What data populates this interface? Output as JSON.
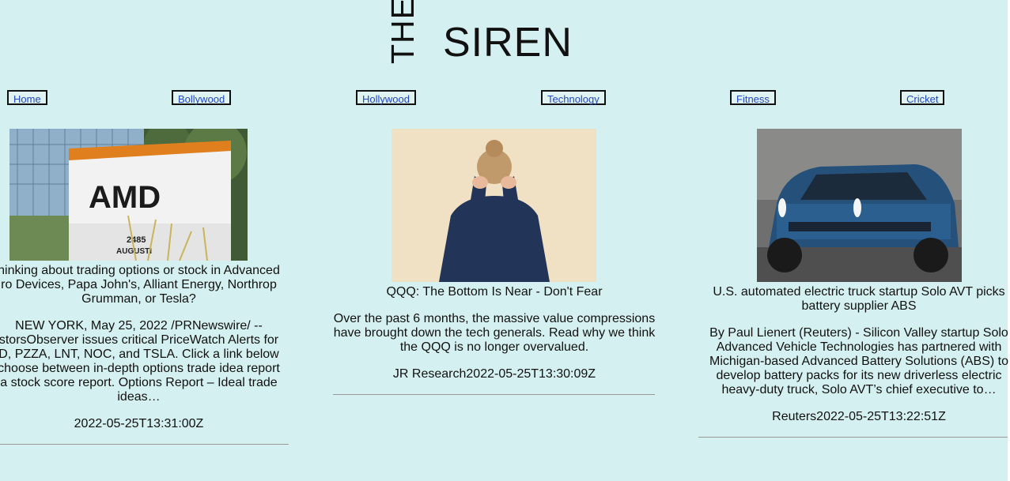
{
  "brand": {
    "the": "THE",
    "name": "SIREN"
  },
  "nav": [
    {
      "label": "Home"
    },
    {
      "label": "Bollywood"
    },
    {
      "label": "Hollywood"
    },
    {
      "label": "Technology"
    },
    {
      "label": "Fitness"
    },
    {
      "label": "Cricket"
    }
  ],
  "articles": [
    {
      "headline": "hinking about trading options or stock in Advanced\nro Devices, Papa John's, Alliant Energy, Northrop\nGrumman, or Tesla?",
      "description": "NEW YORK, May 25, 2022 /PRNewswire/ --\nstorsObserver issues critical PriceWatch Alerts for\nD, PZZA, LNT, NOC, and TSLA. Click a link below\nchoose between in-depth options trade idea report\na stock score report. Options Report – Ideal trade\nideas…",
      "meta": "2022-05-25T13:31:00Z",
      "image_text": {
        "brand": "AMD",
        "sign_number": "2485",
        "sign_street": "AUGUSTI"
      }
    },
    {
      "headline": "QQQ: The Bottom Is Near - Don't Fear",
      "description": "Over the past 6 months, the massive value compressions\nhave brought down the tech generals. Read why we think\nthe QQQ is no longer overvalued.",
      "meta": "JR Research2022-05-25T13:30:09Z"
    },
    {
      "headline": "U.S. automated electric truck startup Solo AVT picks\nbattery supplier ABS",
      "description": "By Paul Lienert (Reuters) - Silicon Valley startup Solo\nAdvanced Vehicle Technologies has partnered with\nMichigan-based Advanced Battery Solutions (ABS) to\ndevelop battery packs for its new driverless electric\nheavy-duty truck, Solo AVT’s chief executive to…",
      "meta": "Reuters2022-05-25T13:22:51Z"
    }
  ],
  "colors": {
    "background": "#d5f0f0",
    "link": "#2246c8",
    "divider": "#999999"
  }
}
